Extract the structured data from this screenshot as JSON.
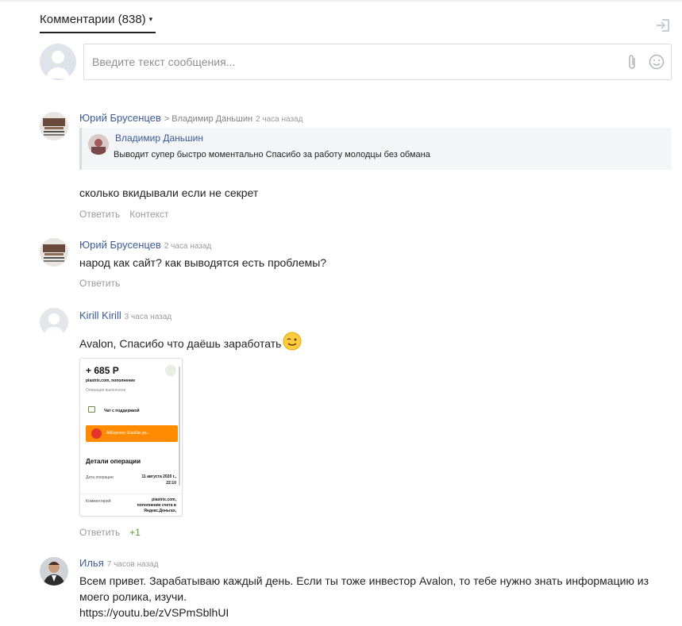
{
  "header": {
    "title": "Комментарии (838)",
    "caret": "▾"
  },
  "composer": {
    "placeholder": "Введите текст сообщения..."
  },
  "comments": [
    {
      "author": "Юрий Брусенцев",
      "reply_to": "> Владимир Даньшин",
      "time": "2 часа назад",
      "quote": {
        "author": "Владимир Даньшин",
        "text": "Выводит супер быстро моментально Спасибо за работу молодцы без обмана"
      },
      "text": "сколько вкидывали если не секрет",
      "actions": [
        "Ответить",
        "Контекст"
      ]
    },
    {
      "author": "Юрий Брусенцев",
      "time": "2 часа назад",
      "text": "народ как сайт? как выводятся есть проблемы?",
      "actions": [
        "Ответить"
      ]
    },
    {
      "author": "Kirill Kirill",
      "time": "3 часа назад",
      "text": "Avalon, Спасибо что даёшь заработать",
      "actions": [
        "Ответить"
      ],
      "rating": "+1",
      "attachment": {
        "amount": "+ 685 Р",
        "subtitle": "piastrix.com, пополнение",
        "status": "Операция выполнена",
        "chat": "Чат с поддержкой",
        "promo": "AliExpress: Кэшбэк до...",
        "details_title": "Детали операции",
        "date_label": "Дата операции",
        "date_value_1": "11 августа 2020 г.,",
        "date_value_2": "22:10",
        "comment_label": "Комментарий",
        "comment_value": "piastrix.com, пополнение счета в Яндекс.Деньгах,"
      }
    },
    {
      "author": "Илья",
      "time": "7 часов назад",
      "text_line1": "Всем привет. Зарабатываю каждый день. Если ты тоже инвестор Avalon, то тебе нужно знать информацию из",
      "text_line2": "моего ролика, изучи.",
      "link": "https://youtu.be/zVSPmSblhUI"
    }
  ]
}
